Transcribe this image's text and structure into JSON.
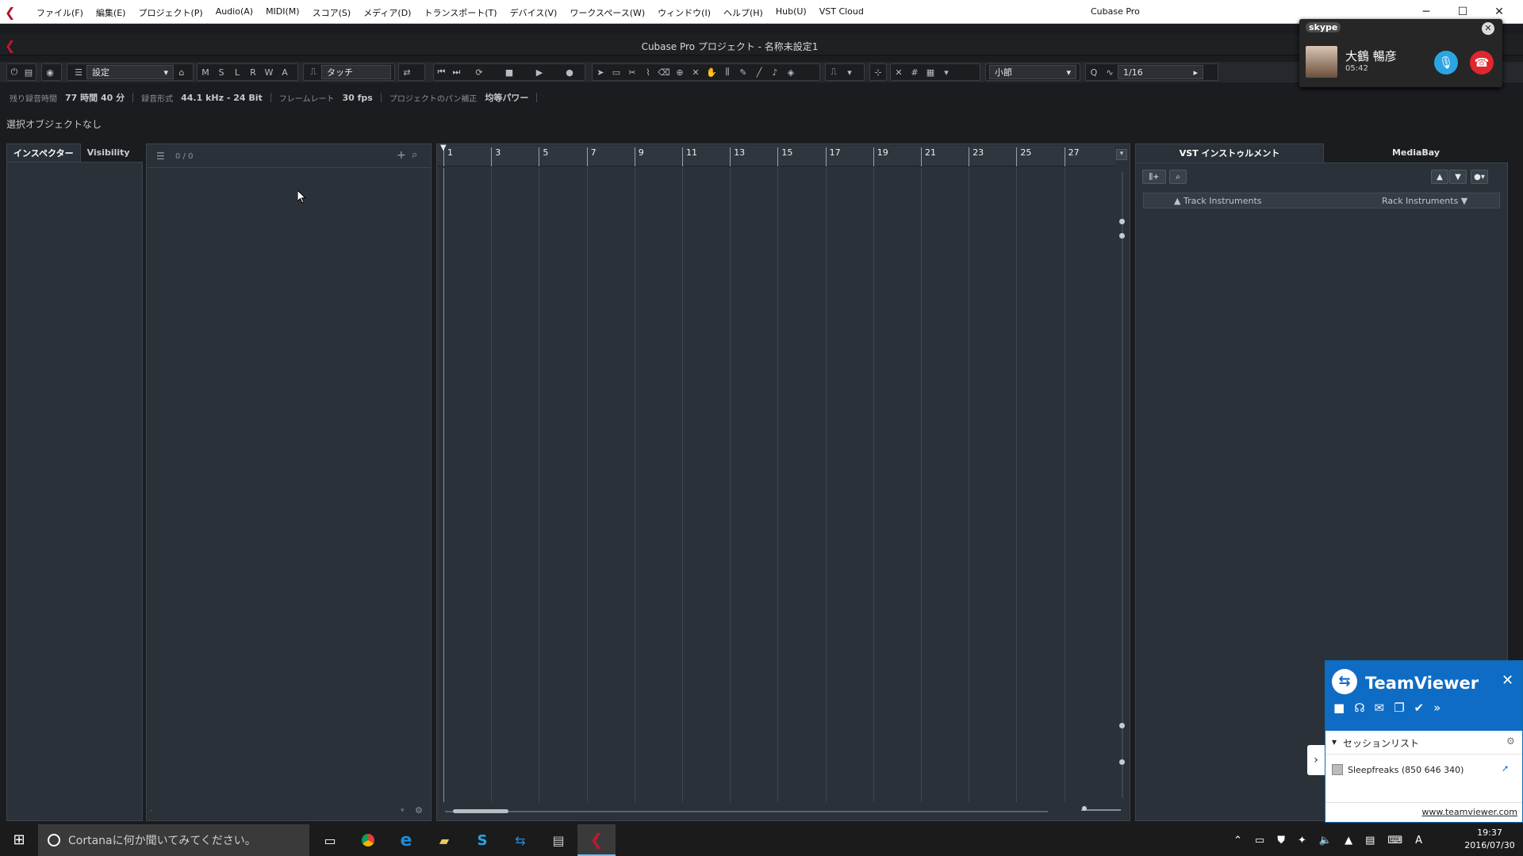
{
  "menubar": {
    "items": [
      "ファイル(F)",
      "編集(E)",
      "プロジェクト(P)",
      "Audio(A)",
      "MIDI(M)",
      "スコア(S)",
      "メディア(D)",
      "トランスポート(T)",
      "デバイス(V)",
      "ワークスペース(W)",
      "ウィンドウ(I)",
      "ヘルプ(H)",
      "Hub(U)",
      "VST Cloud"
    ],
    "app_title": "Cubase Pro",
    "min": "─",
    "max": "☐",
    "close": "✕"
  },
  "window": {
    "title": "Cubase Pro プロジェクト - 名称未設定1"
  },
  "toolbar": {
    "preset": "設定",
    "msl": [
      "M",
      "S",
      "L",
      "R",
      "W",
      "A"
    ],
    "automation_mode": "タッチ",
    "grid_type": "小節",
    "quantize": "1/16",
    "quantize_label": "Q"
  },
  "status": {
    "rec_time_label": "残り録音時間",
    "rec_time": "77 時間 40 分",
    "rec_format_label": "録音形式",
    "rec_format": "44.1 kHz - 24 Bit",
    "framerate_label": "フレームレート",
    "framerate": "30 fps",
    "pan_label": "プロジェクトのパン補正",
    "pan": "均等パワー"
  },
  "info_line": "選択オブジェクトなし",
  "inspector": {
    "tabs": [
      "インスペクター",
      "Visibility"
    ]
  },
  "tracklist": {
    "count": "0 / 0"
  },
  "ruler": {
    "bars": [
      "1",
      "3",
      "5",
      "7",
      "9",
      "11",
      "13",
      "15",
      "17",
      "19",
      "21",
      "23",
      "25",
      "27"
    ]
  },
  "right_zone": {
    "tabs": [
      "VST インストゥルメント",
      "MediaBay"
    ],
    "track_instruments": "Track Instruments",
    "rack_instruments": "Rack Instruments"
  },
  "skype": {
    "brand": "skype",
    "caller": "大鶴 暢彦",
    "duration": "05:42"
  },
  "teamviewer": {
    "brand": "TeamViewer",
    "session_list": "セッションリスト",
    "partner": "Sleepfreaks (850 646 340)",
    "url": "www.teamviewer.com"
  },
  "taskbar": {
    "search_placeholder": "Cortanaに何か聞いてみてください。",
    "time": "19:37",
    "date": "2016/07/30",
    "ime": "A"
  },
  "colors": {
    "cubase_red": "#c01830",
    "panel_bg": "#2b3139",
    "teamviewer_blue": "#0e6cc4",
    "skype_blue": "#2aa5e3",
    "hangup_red": "#e0262f"
  }
}
